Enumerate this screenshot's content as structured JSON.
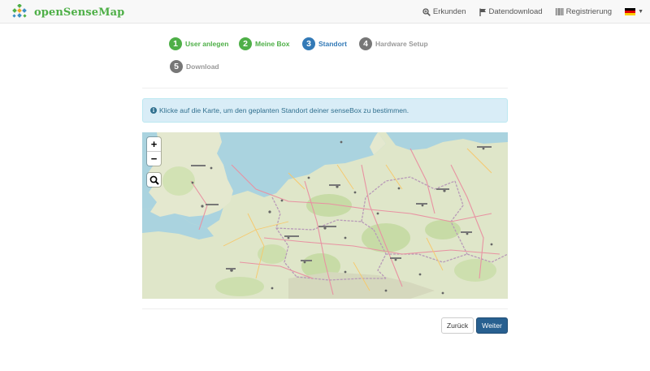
{
  "navbar": {
    "brand": "openSenseMap",
    "links": [
      {
        "label": "Erkunden",
        "icon": "zoom-in-icon"
      },
      {
        "label": "Datendownload",
        "icon": "flag-download-icon"
      },
      {
        "label": "Registrierung",
        "icon": "barcode-icon"
      }
    ],
    "language": {
      "icon": "german-flag-icon",
      "colors": [
        "#000000",
        "#dd0000",
        "#ffce00"
      ]
    }
  },
  "steps": [
    {
      "number": "1",
      "label": "User anlegen",
      "state": "done"
    },
    {
      "number": "2",
      "label": "Meine Box",
      "state": "done"
    },
    {
      "number": "3",
      "label": "Standort",
      "state": "active"
    },
    {
      "number": "4",
      "label": "Hardware Setup",
      "state": "todo"
    },
    {
      "number": "5",
      "label": "Download",
      "state": "todo"
    }
  ],
  "alert": {
    "icon": "info-circle-icon",
    "text": "Klicke auf die Karte, um den geplanten Standort deiner senseBox zu bestimmen."
  },
  "map": {
    "zoom_in": "+",
    "zoom_out": "−",
    "search_icon": "search-icon"
  },
  "buttons": {
    "back": "Zurück",
    "next": "Weiter"
  },
  "colors": {
    "brand": "#4eaf47",
    "primary": "#337ab7",
    "primary_dark": "#286090",
    "alert_bg": "#d9edf7",
    "alert_text": "#31708f"
  }
}
